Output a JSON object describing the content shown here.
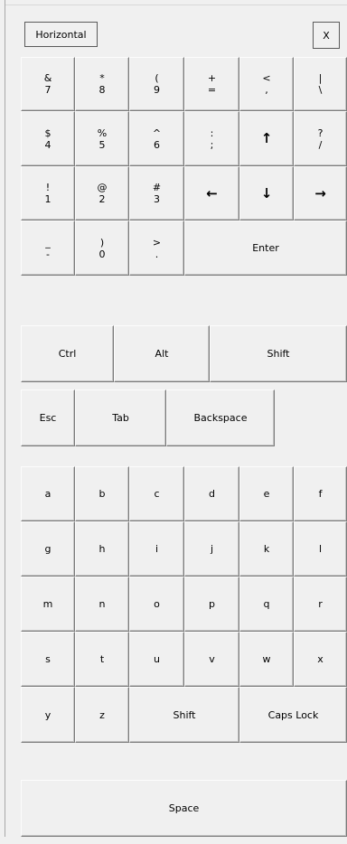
{
  "header": {
    "orientation_button": "Horizontal",
    "close_button": "X"
  },
  "symbols": {
    "amp7": [
      "&",
      "7"
    ],
    "star8": [
      "*",
      "8"
    ],
    "paren9": [
      "(",
      "9"
    ],
    "plus_eq": [
      "+",
      "="
    ],
    "lt_comma": [
      "<",
      ","
    ],
    "pipe_bslash": [
      "|",
      "\\"
    ],
    "dollar4": [
      "$",
      "4"
    ],
    "pct5": [
      "%",
      "5"
    ],
    "caret6": [
      "^",
      "6"
    ],
    "colon_semi": [
      ":",
      ";"
    ],
    "q_slash": [
      "?",
      "/"
    ],
    "excl1": [
      "!",
      "1"
    ],
    "at2": [
      "@",
      "2"
    ],
    "hash3": [
      "#",
      "3"
    ],
    "under_minus": [
      "_",
      "-"
    ],
    "rparen0": [
      ")",
      "0"
    ],
    "gt_period": [
      ">",
      "."
    ]
  },
  "arrows": {
    "up": "↑",
    "left": "←",
    "down": "↓",
    "right": "→"
  },
  "keys": {
    "enter": "Enter",
    "ctrl": "Ctrl",
    "alt": "Alt",
    "shift": "Shift",
    "esc": "Esc",
    "tab": "Tab",
    "backspace": "Backspace",
    "shift2": "Shift",
    "caps_lock": "Caps Lock",
    "space": "Space"
  },
  "letters": [
    "a",
    "b",
    "c",
    "d",
    "e",
    "f",
    "g",
    "h",
    "i",
    "j",
    "k",
    "l",
    "m",
    "n",
    "o",
    "p",
    "q",
    "r",
    "s",
    "t",
    "u",
    "v",
    "w",
    "x",
    "y",
    "z"
  ]
}
